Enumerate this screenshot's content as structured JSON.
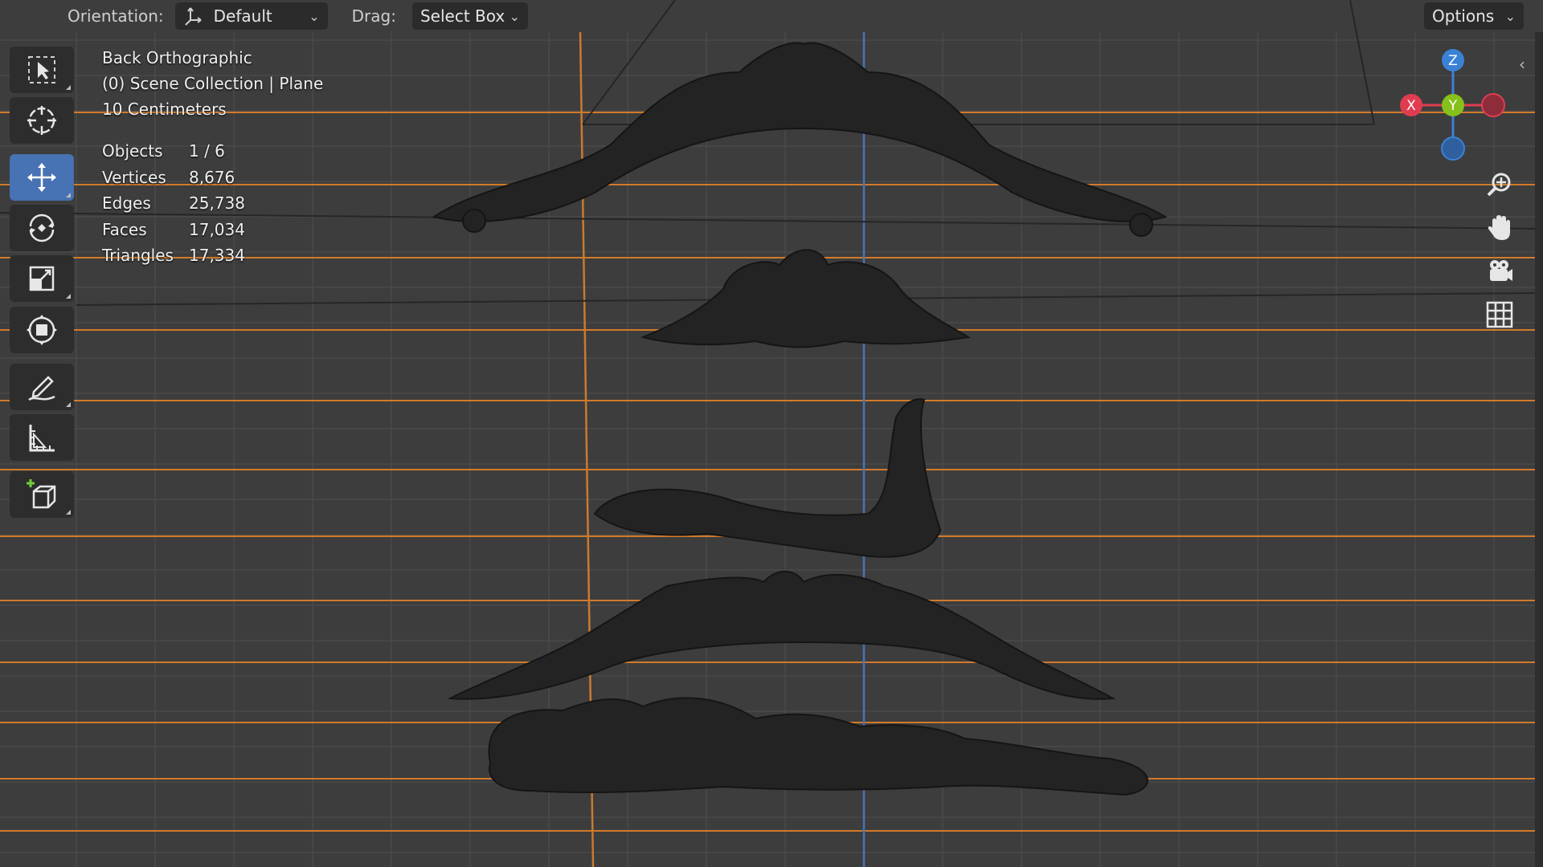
{
  "header": {
    "orientation_label": "Orientation:",
    "orientation_value": "Default",
    "drag_label": "Drag:",
    "drag_value": "Select Box",
    "options_label": "Options"
  },
  "tools": [
    {
      "name": "select-box-tool",
      "icon": "cursor-select-icon",
      "active": false
    },
    {
      "name": "cursor-tool",
      "icon": "crosshair-cursor-icon",
      "active": false
    },
    {
      "name": "move-tool",
      "icon": "move-arrows-icon",
      "active": true
    },
    {
      "name": "rotate-tool",
      "icon": "rotate-icon",
      "active": false
    },
    {
      "name": "scale-tool",
      "icon": "scale-icon",
      "active": false
    },
    {
      "name": "transform-tool",
      "icon": "transform-icon",
      "active": false
    },
    {
      "name": "annotate-tool",
      "icon": "pencil-icon",
      "active": false
    },
    {
      "name": "measure-tool",
      "icon": "ruler-icon",
      "active": false
    },
    {
      "name": "add-cube-tool",
      "icon": "add-cube-icon",
      "active": false
    }
  ],
  "viewport": {
    "view_name": "Back Orthographic",
    "collection": "(0) Scene Collection | Plane",
    "grid_scale": "10 Centimeters"
  },
  "stats": [
    {
      "label": "Objects",
      "value": "1 / 6"
    },
    {
      "label": "Vertices",
      "value": "8,676"
    },
    {
      "label": "Edges",
      "value": "25,738"
    },
    {
      "label": "Faces",
      "value": "17,034"
    },
    {
      "label": "Triangles",
      "value": "17,334"
    }
  ],
  "gizmo": {
    "z_label": "Z",
    "y_label": "Y",
    "x_label": "X",
    "colors": {
      "x": "#e03c50",
      "y": "#86c11b",
      "z": "#3b82d6",
      "grid_orange": "#d27a2a",
      "grid_line": "#4a4a4a",
      "background": "#3d3d3d",
      "active_tool": "#4772b3"
    }
  },
  "nav_buttons": [
    {
      "name": "zoom-button",
      "icon": "zoom-icon"
    },
    {
      "name": "pan-button",
      "icon": "hand-icon"
    },
    {
      "name": "camera-view-button",
      "icon": "camera-icon"
    },
    {
      "name": "toggle-ortho-button",
      "icon": "grid-icon"
    }
  ]
}
